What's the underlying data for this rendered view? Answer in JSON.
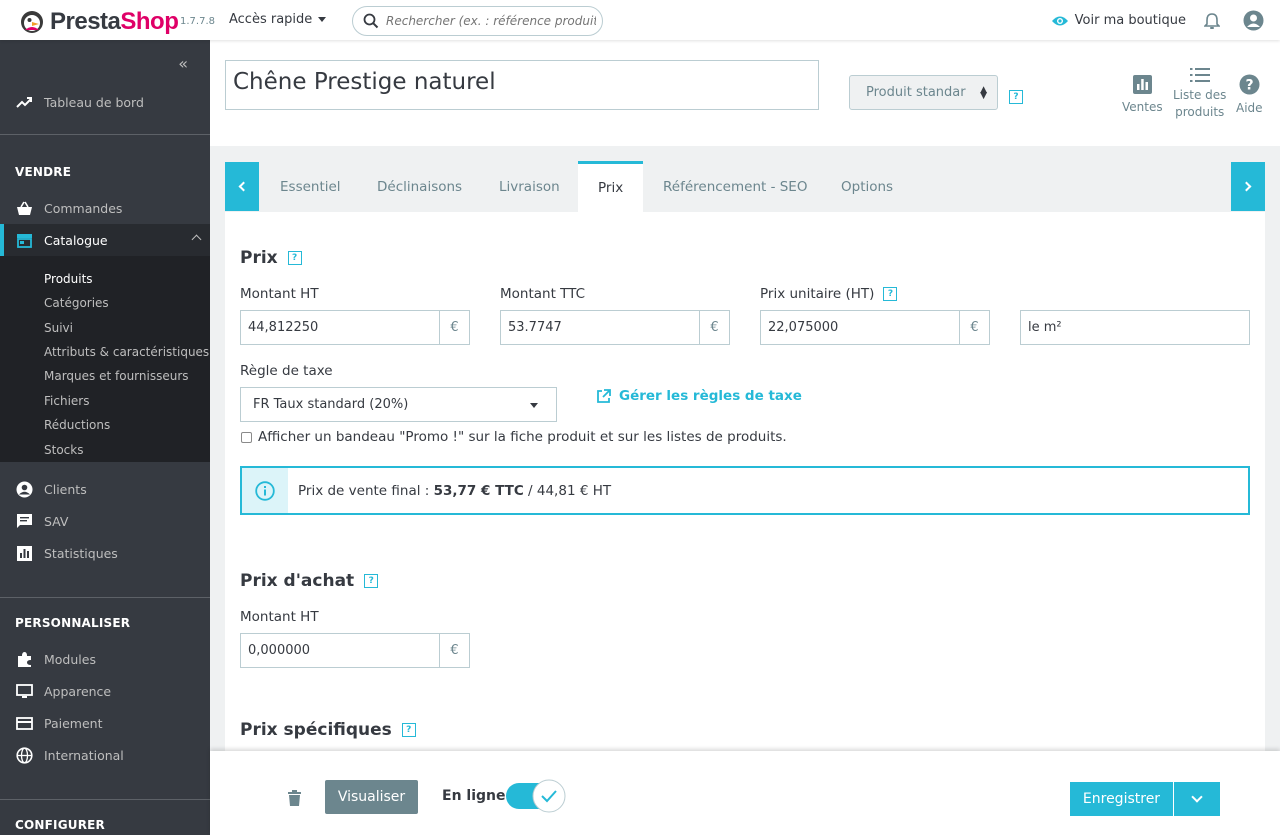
{
  "header": {
    "brand_a": "Presta",
    "brand_b": "Shop",
    "version": "1.7.7.8",
    "quick_access": "Accès rapide",
    "search_placeholder": "Rechercher (ex. : référence produit, nom",
    "view_shop": "Voir ma boutique"
  },
  "sidebar": {
    "dashboard": "Tableau de bord",
    "section_sell": "VENDRE",
    "orders": "Commandes",
    "catalog": "Catalogue",
    "catalog_sub": [
      "Produits",
      "Catégories",
      "Suivi",
      "Attributs & caractéristiques",
      "Marques et fournisseurs",
      "Fichiers",
      "Réductions",
      "Stocks"
    ],
    "customers": "Clients",
    "sav": "SAV",
    "stats": "Statistiques",
    "section_custom": "PERSONNALISER",
    "modules": "Modules",
    "appearance": "Apparence",
    "payment": "Paiement",
    "international": "International",
    "section_config": "CONFIGURER"
  },
  "toolbar": {
    "product_name": "Chêne Prestige naturel",
    "product_type": "Produit standar",
    "help": "?",
    "sales": "Ventes",
    "product_list_1": "Liste des",
    "product_list_2": "produits",
    "help_btn": "Aide"
  },
  "tabs": [
    "Essentiel",
    "Déclinaisons",
    "Livraison",
    "Prix",
    "Référencement - SEO",
    "Options"
  ],
  "prices": {
    "title": "Prix",
    "amount_ht_label": "Montant HT",
    "amount_ht": "44,812250",
    "amount_ttc_label": "Montant TTC",
    "amount_ttc": "53.7747",
    "unit_price_label": "Prix unitaire (HT)",
    "unit_price": "22,075000",
    "unit": "le m²",
    "currency": "€",
    "tax_rule_label": "Règle de taxe",
    "tax_rule": "FR Taux standard (20%)",
    "manage_tax": "Gérer les règles de taxe",
    "promo_label": "Afficher un bandeau \"Promo !\" sur la fiche produit et sur les listes de produits.",
    "final_price_prefix": "Prix de vente final : ",
    "final_price_ttc": "53,77 € TTC",
    "final_price_ht": " / 44,81 € HT"
  },
  "purchase": {
    "title": "Prix d'achat",
    "amount_ht_label": "Montant HT",
    "amount_ht": "0,000000"
  },
  "specific": {
    "title": "Prix spécifiques"
  },
  "footer": {
    "preview": "Visualiser",
    "online": "En ligne",
    "save": "Enregistrer"
  },
  "colors": {
    "accent": "#25b9d7",
    "sidebar": "#363a41",
    "brand_pink": "#df0067"
  }
}
